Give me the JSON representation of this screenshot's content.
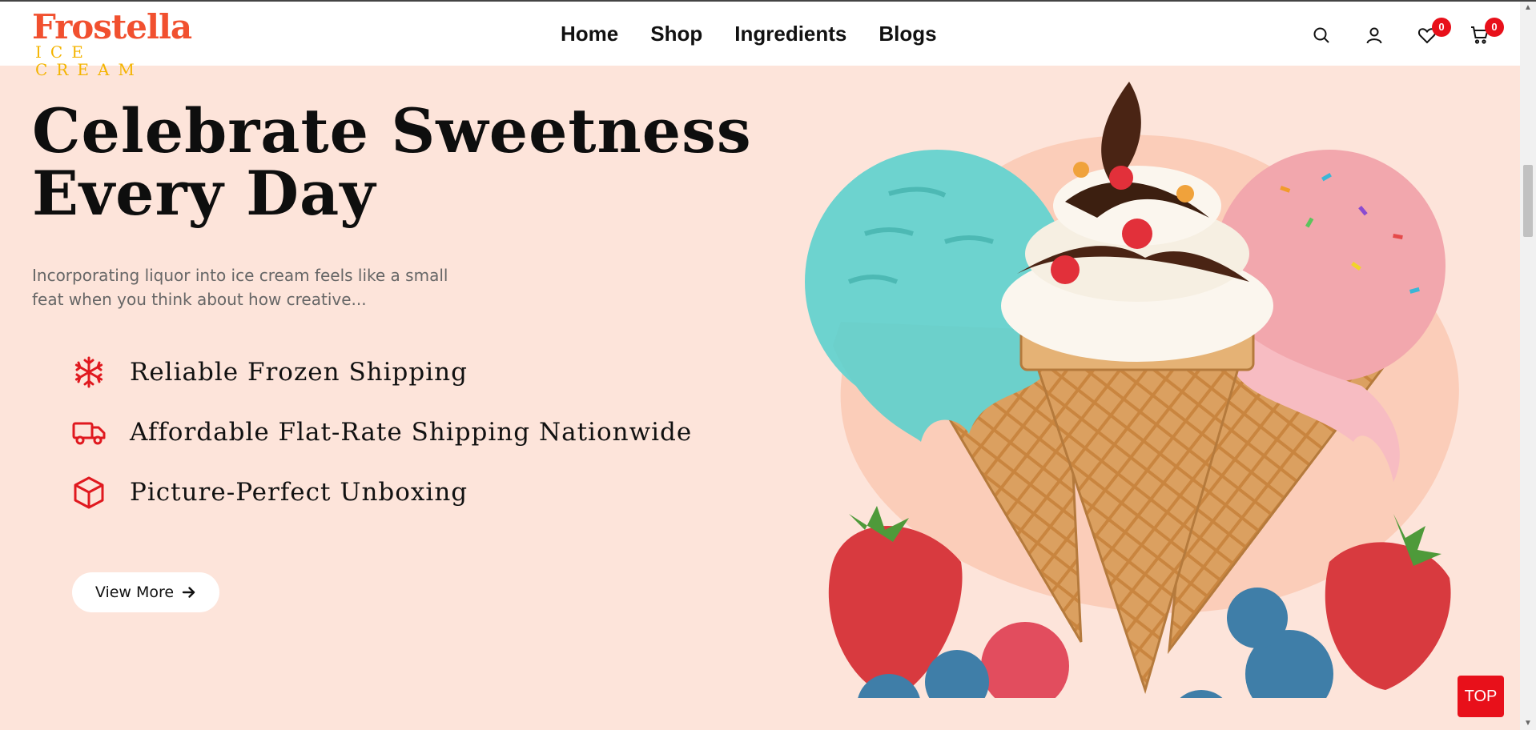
{
  "brand": {
    "name": "Frostella",
    "tagline": "ICE CREAM",
    "color": "#f1502f",
    "tagline_color": "#f4b400"
  },
  "nav": {
    "items": [
      "Home",
      "Shop",
      "Ingredients",
      "Blogs"
    ]
  },
  "header_icons": {
    "search": "search-icon",
    "account": "user-icon",
    "wishlist": {
      "icon": "heart-icon",
      "count": "0"
    },
    "cart": {
      "icon": "cart-icon",
      "count": "0"
    }
  },
  "hero": {
    "title_line1": "Celebrate Sweetness",
    "title_line2": "Every Day",
    "description_line1": "Incorporating liquor into ice cream feels like a small",
    "description_line2": "feat when you think about how creative...",
    "features": [
      {
        "icon": "snowflake-icon",
        "label": "Reliable Frozen Shipping"
      },
      {
        "icon": "truck-icon",
        "label": "Affordable Flat-Rate Shipping Nationwide"
      },
      {
        "icon": "box-icon",
        "label": "Picture-Perfect Unboxing"
      }
    ],
    "cta_label": "View More",
    "image": "ice-cream-cones-image"
  },
  "back_to_top_label": "TOP",
  "colors": {
    "accent": "#e8101a",
    "hero_bg": "#fde4da"
  }
}
